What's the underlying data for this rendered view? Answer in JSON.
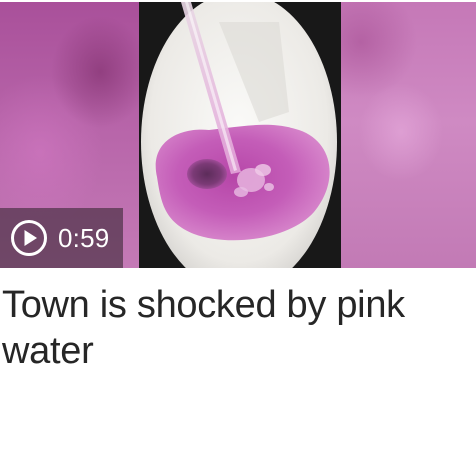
{
  "video": {
    "duration": "0:59",
    "play_icon": "play-circle-icon"
  },
  "headline": {
    "title": "Town is shocked by pink water"
  },
  "colors": {
    "headline_text": "#262626",
    "badge_background": "rgba(60,40,55,0.62)",
    "pink_water": "#c45db8"
  }
}
